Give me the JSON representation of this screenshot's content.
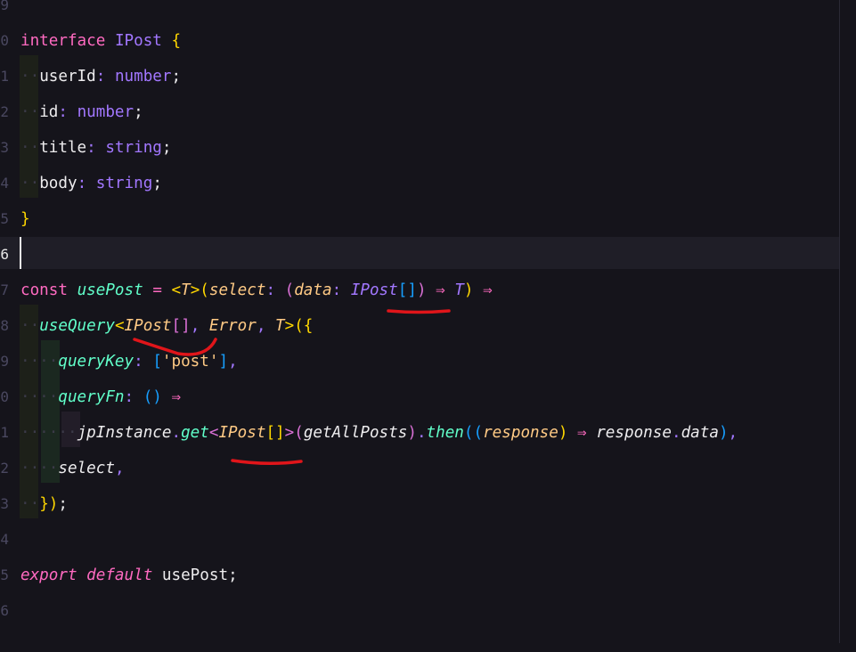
{
  "editor": {
    "line_numbers": [
      "9",
      "0",
      "1",
      "2",
      "3",
      "4",
      "5",
      "6",
      "7",
      "8",
      "9",
      "0",
      "1",
      "2",
      "3",
      "4",
      "5",
      "6"
    ],
    "lines": {
      "l10": {
        "kw": "interface",
        "name": "IPost",
        "open": "{"
      },
      "l11": {
        "prop": "userId",
        "colon": ":",
        "type": "number",
        "semi": ";"
      },
      "l12": {
        "prop": "id",
        "colon": ":",
        "type": "number",
        "semi": ";"
      },
      "l13": {
        "prop": "title",
        "colon": ":",
        "type": "string",
        "semi": ";"
      },
      "l14": {
        "prop": "body",
        "colon": ":",
        "type": "string",
        "semi": ";"
      },
      "l15": {
        "close": "}"
      },
      "l17": {
        "kw": "const",
        "name": "usePost",
        "eq": "=",
        "lt": "<",
        "tparam": "T",
        "gt": ">",
        "p1": "(",
        "param": "select",
        "colon": ":",
        "p2": "(",
        "param2": "data",
        "colon2": ":",
        "type": "IPost",
        "arr": "[]",
        "p2c": ")",
        "arrow": "⇒",
        "rtype": "T",
        "p1c": ")",
        "arrow2": "⇒"
      },
      "l18": {
        "fn": "useQuery",
        "lt": "<",
        "type": "IPost",
        "arr": "[]",
        "comma": ",",
        "err": "Error",
        "comma2": ",",
        "tparam": "T",
        "gt": ">",
        "open": "({"
      },
      "l19": {
        "prop": "queryKey",
        "colon": ":",
        "bo": "[",
        "str": "'post'",
        "bc": "]",
        "comma": ","
      },
      "l20": {
        "prop": "queryFn",
        "colon": ":",
        "parens": "()",
        "arrow": "⇒"
      },
      "l21": {
        "obj": "jpInstance",
        "dot": ".",
        "method": "get",
        "lt": "<",
        "type": "IPost",
        "arr": "[]",
        "gt": ">",
        "po": "(",
        "arg": "getAllPosts",
        "pc": ")",
        "dot2": ".",
        "method2": "then",
        "po2": "((",
        "param": "response",
        "pc2": ")",
        "arrow": "⇒",
        "expr": "response",
        "dot3": ".",
        "field": "data",
        "pc3": ")",
        "comma": ","
      },
      "l22": {
        "prop": "select",
        "comma": ","
      },
      "l23": {
        "close": "})",
        "semi": ";"
      },
      "l25": {
        "kw": "export",
        "kw2": "default",
        "name": "usePost",
        "semi": ";"
      }
    }
  },
  "colors": {
    "background": "#15141b",
    "annotation": "#e0151a",
    "keyword": "#ff6ac1",
    "type": "#a277ff",
    "function": "#61ffca",
    "type_param": "#ffca85"
  }
}
